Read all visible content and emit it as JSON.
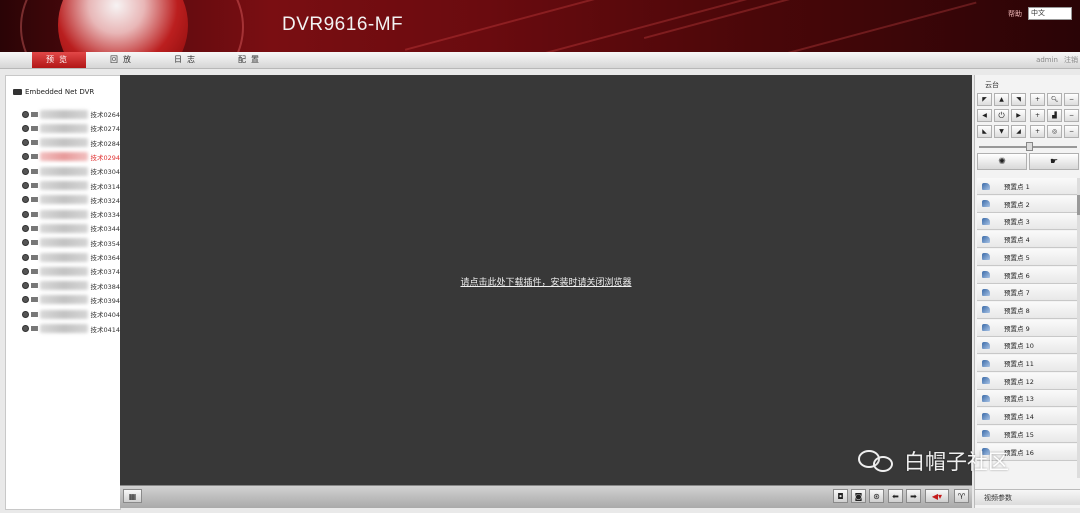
{
  "header": {
    "title": "DVR9616-MF",
    "help": "帮助",
    "language": "中文"
  },
  "nav": {
    "tabs": [
      "预览",
      "回放",
      "日志",
      "配置"
    ],
    "active": 0,
    "user": "admin",
    "logout": "注销"
  },
  "device_tree": {
    "root": "Embedded Net DVR",
    "cameras": [
      {
        "label": "技术0264",
        "selected": false
      },
      {
        "label": "技术0274",
        "selected": false
      },
      {
        "label": "技术0284",
        "selected": false
      },
      {
        "label": "技术0294",
        "selected": true
      },
      {
        "label": "技术0304",
        "selected": false
      },
      {
        "label": "技术0314",
        "selected": false
      },
      {
        "label": "技术0324",
        "selected": false
      },
      {
        "label": "技术0334",
        "selected": false
      },
      {
        "label": "技术0344",
        "selected": false
      },
      {
        "label": "技术0354",
        "selected": false
      },
      {
        "label": "技术0364",
        "selected": false
      },
      {
        "label": "技术0374",
        "selected": false
      },
      {
        "label": "技术0384",
        "selected": false
      },
      {
        "label": "技术0394",
        "selected": false
      },
      {
        "label": "技术0404",
        "selected": false
      },
      {
        "label": "技术0414",
        "selected": false
      }
    ]
  },
  "video": {
    "plugin_message": "请点击此处下载插件，安装时请关闭浏览器"
  },
  "ptz": {
    "title": "云台",
    "presets": [
      "预置点 1",
      "预置点 2",
      "预置点 3",
      "预置点 4",
      "预置点 5",
      "预置点 6",
      "预置点 7",
      "预置点 8",
      "预置点 9",
      "预置点 10",
      "预置点 11",
      "预置点 12",
      "预置点 13",
      "预置点 14",
      "预置点 15",
      "预置点 16"
    ],
    "video_params": "视频参数"
  },
  "watermark": {
    "text": "白帽子社区"
  },
  "colors": {
    "accent": "#c41a1a",
    "video_bg": "#383838",
    "selected_text": "#e03030"
  }
}
